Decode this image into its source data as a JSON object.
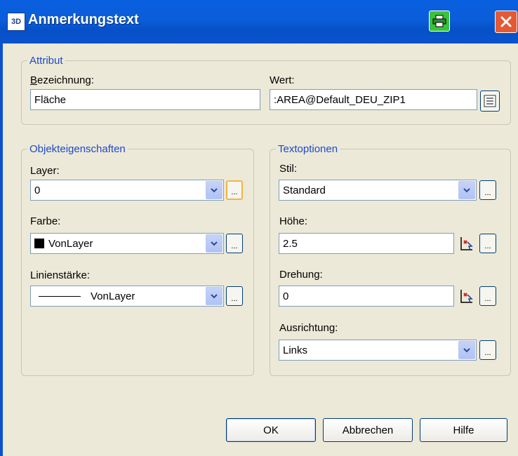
{
  "window": {
    "title": "Anmerkungstext",
    "app_icon": "app-icon"
  },
  "attribut": {
    "legend": "Attribut",
    "bezeichnung_label": "Bezeichnung:",
    "bezeichnung_value": "Fläche",
    "wert_label": "Wert:",
    "wert_value": ":AREA@Default_DEU_ZIP1"
  },
  "objekt": {
    "legend": "Objekteigenschaften",
    "layer_label": "Layer:",
    "layer_value": "0",
    "farbe_label": "Farbe:",
    "farbe_value": "VonLayer",
    "linienstaerke_label": "Linienstärke:",
    "linienstaerke_value": "VonLayer"
  },
  "text": {
    "legend": "Textoptionen",
    "stil_label": "Stil:",
    "stil_value": "Standard",
    "hoehe_label": "Höhe:",
    "hoehe_value": "2.5",
    "drehung_label": "Drehung:",
    "drehung_value": "0",
    "ausrichtung_label": "Ausrichtung:",
    "ausrichtung_value": "Links"
  },
  "ellipsis": "...",
  "buttons": {
    "ok": "OK",
    "cancel": "Abbrechen",
    "help": "Hilfe"
  },
  "colors": {
    "title_bar": "#0b5ed9",
    "legend": "#1d49c9",
    "dialog_bg": "#ece9d8",
    "close": "#e35a35",
    "print": "#3ac23a"
  }
}
